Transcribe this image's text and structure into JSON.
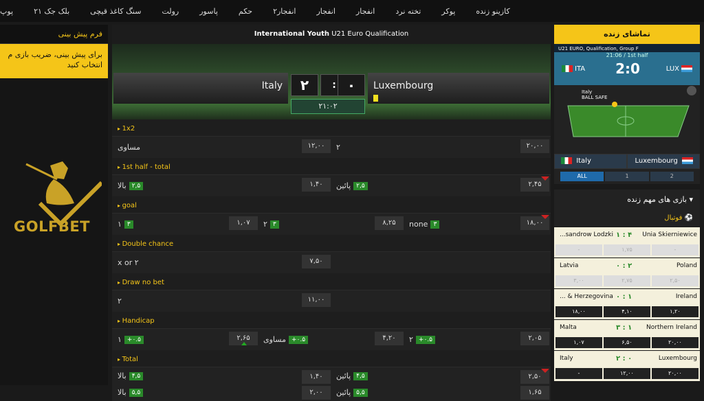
{
  "nav": [
    "کازینو زنده",
    "پوکر",
    "تخته نرد",
    "انفجار",
    "انفجار",
    "انفجار۲",
    "حکم",
    "پاسور",
    "رولت",
    "سنگ کاغذ قیچی",
    "بلک جک ۲۱",
    "پوپ"
  ],
  "left": {
    "header": "فرم پیش بینی",
    "note_line1": "برای پیش بینی، ضریب بازی م",
    "note_line2": "انتخاب کنید",
    "logo": "GOLFBET"
  },
  "match": {
    "title_bold": "International Youth",
    "title_rest": " U21 Euro Qualification",
    "home": "Italy",
    "away": "Luxembourg",
    "home_score": "۲",
    "away_score": "۰",
    "sep": ":",
    "time": "۲۱:۰۲"
  },
  "markets": {
    "m1": "1x2",
    "m1_draw": "مساوی",
    "m1_draw_odd": "۱۲,۰۰",
    "m1_two": "۲",
    "m1_one_odd": "۲۰,۰۰",
    "m2": "1st half - total",
    "m2_over": "بالا",
    "m2_over_b": "۲,۵",
    "m2_over_odd": "۱,۴۰",
    "m2_under": "پائین",
    "m2_under_b": "۲,۵",
    "m2_under_odd": "۲,۴۵",
    "m3": "goal",
    "m3_one": "۱",
    "m3_one_b": "۳",
    "m3_odd1": "۱,۰۷",
    "m3_two": "۲",
    "m3_two_b": "۳",
    "m3_odd2": "۸,۲۵",
    "m3_none": "none",
    "m3_none_b": "۳",
    "m3_odd3": "۱۸,۰۰",
    "m4": "Double chance",
    "m4_lbl": "x or ۲",
    "m4_odd": "۷,۵۰",
    "m5": "Draw no bet",
    "m5_lbl": "۲",
    "m5_odd": "۱۱,۰۰",
    "m6": "Handicap",
    "m6_one": "۱",
    "m6_b1": "+۰.۵",
    "m6_odd1": "۲,۶۵",
    "m6_draw": "مساوی",
    "m6_b2": "+۰.۵",
    "m6_odd2": "۴,۲۰",
    "m6_two": "۲",
    "m6_b3": "+۰.۵",
    "m6_odd3": "۲,۰۵",
    "m7": "Total",
    "m7_r1_over": "بالا",
    "m7_r1_b": "۴,۵",
    "m7_r1_odd1": "۱,۴۰",
    "m7_r1_under": "پائین",
    "m7_r1_b2": "۴,۵",
    "m7_r1_odd2": "۲,۵۰",
    "m7_r2_over": "بالا",
    "m7_r2_b": "۵,۵",
    "m7_r2_odd1": "۲,۰۰",
    "m7_r2_under": "پائین",
    "m7_r2_b2": "۵,۵",
    "m7_r2_odd2": "۱,۶۵"
  },
  "live": {
    "header": "تماشای زنده",
    "comp": "U21 EURO, Qualification, Group F",
    "time": "21:06 / 1st half",
    "home": "ITA",
    "away": "LUX",
    "score": "2:0",
    "pitch_team": "Italy",
    "pitch_label": "BALL SAFE",
    "team_home": "Italy",
    "team_away": "Luxembourg",
    "tabs": [
      "ALL",
      "1",
      "2"
    ]
  },
  "important": {
    "header": "بازی های مهم زنده",
    "sport": "فوتبال",
    "matches": [
      {
        "home": "...sandrow Lodzki",
        "score": "۱ : ۴",
        "away": "Unia Skierniewice",
        "odds": [
          "-",
          "۱,۷۵",
          "-"
        ],
        "on": false
      },
      {
        "home": "Latvia",
        "score": "۰ : ۲",
        "away": "Poland",
        "odds": [
          "۳,۰۰",
          "۲,۷۵",
          "۲,۵۰"
        ],
        "on": false
      },
      {
        "home": "... & Herzegovina",
        "score": "۰ : ۱",
        "away": "Ireland",
        "odds": [
          "۱۸,۰۰",
          "۴,۱۰",
          "۱,۲۰"
        ],
        "on": true
      },
      {
        "home": "Malta",
        "score": "۳ : ۱",
        "away": "Northern Ireland",
        "odds": [
          "۱,۰۷",
          "۶,۵۰",
          "۲۰,۰۰"
        ],
        "on": true
      },
      {
        "home": "Italy",
        "score": "۲ : ۰",
        "away": "Luxembourg",
        "odds": [
          "-",
          "۱۲,۰۰",
          "۲۰,۰۰"
        ],
        "on": true
      }
    ]
  },
  "colors": {
    "accent": "#f5c518",
    "green": "#2a8a2a",
    "blue": "#2a6f8f"
  }
}
